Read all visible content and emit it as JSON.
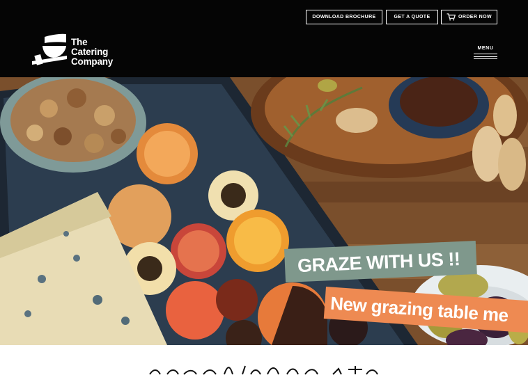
{
  "header": {
    "buttons": {
      "download_brochure": "DOWNLOAD BROCHURE",
      "get_a_quote": "GET A QUOTE",
      "order_now": "ORDER NOW"
    },
    "logo": {
      "line1": "The",
      "line2": "Catering",
      "line3": "Company"
    },
    "menu_label": "MENU"
  },
  "hero": {
    "banner_primary": "GRAZE WITH US !!",
    "banner_secondary": "New grazing table me",
    "banner_primary_color": "#7f988c",
    "banner_secondary_color": "#ee8a52"
  },
  "below_fold": {
    "script_heading": ""
  },
  "icons": {
    "cart": "cart-icon",
    "menu": "hamburger-icon"
  }
}
